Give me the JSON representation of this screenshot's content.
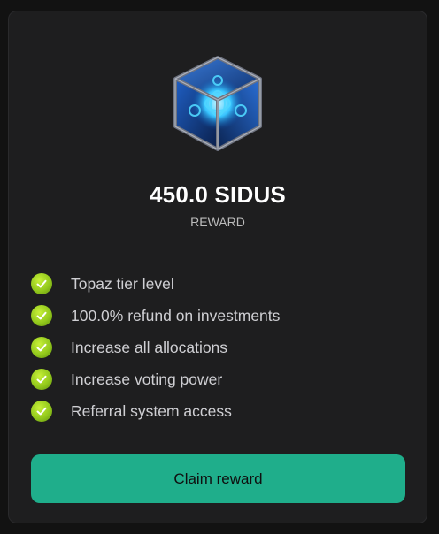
{
  "reward": {
    "amount": "450.0 SIDUS",
    "label": "REWARD",
    "icon": "crystal-cube-icon"
  },
  "perks": [
    {
      "icon": "check-icon",
      "text": "Topaz tier level"
    },
    {
      "icon": "check-icon",
      "text": "100.0% refund on investments"
    },
    {
      "icon": "check-icon",
      "text": "Increase all allocations"
    },
    {
      "icon": "check-icon",
      "text": "Increase voting power"
    },
    {
      "icon": "check-icon",
      "text": "Referral system access"
    }
  ],
  "actions": {
    "claim_label": "Claim reward"
  },
  "colors": {
    "background": "#121212",
    "card": "#1e1e1f",
    "accent": "#1fae8b",
    "check": "#9fd21f"
  }
}
